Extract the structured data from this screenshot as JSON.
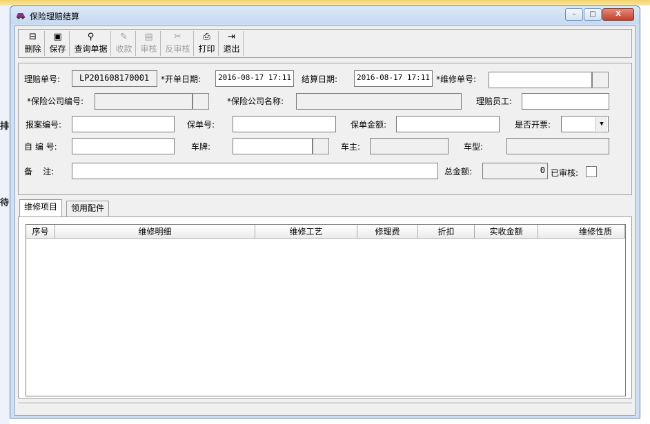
{
  "window": {
    "title": "保险理赔结算",
    "buttons": {
      "minimize": "–",
      "maximize": "□",
      "close": "X"
    }
  },
  "desktop": {
    "left_chars": [
      "排",
      "待"
    ]
  },
  "toolbar": [
    {
      "label": "删除",
      "icon": "delete-icon",
      "glyph": "⊟",
      "enabled": true
    },
    {
      "label": "保存",
      "icon": "save-icon",
      "glyph": "▣",
      "enabled": true
    },
    {
      "label": "查询单据",
      "icon": "binoculars-icon",
      "glyph": "⚲",
      "enabled": true
    },
    {
      "label": "收款",
      "icon": "receive-icon",
      "glyph": "✎",
      "enabled": false
    },
    {
      "label": "审核",
      "icon": "audit-icon",
      "glyph": "▤",
      "enabled": false
    },
    {
      "label": "反审核",
      "icon": "unaudit-icon",
      "glyph": "✂",
      "enabled": false
    },
    {
      "label": "打印",
      "icon": "printer-icon",
      "glyph": "⎙",
      "enabled": true
    },
    {
      "label": "退出",
      "icon": "exit-icon",
      "glyph": "⇥",
      "enabled": true
    }
  ],
  "form": {
    "claim_no_label": "理赔单号:",
    "claim_no": "LP201608170001",
    "open_date_label": "*开单日期:",
    "open_date": "2016-08-17 17:11",
    "settle_date_label": "结算日期:",
    "settle_date": "2016-08-17 17:11",
    "repair_no_label": "*维修单号:",
    "repair_no": "",
    "ins_code_label": "*保险公司编号:",
    "ins_code": "",
    "ins_name_label": "*保险公司名称:",
    "ins_name": "",
    "claim_staff_label": "理赔员工:",
    "claim_staff": "",
    "report_no_label": "报案编号:",
    "report_no": "",
    "policy_no_label": "保单号:",
    "policy_no": "",
    "policy_amount_label": "保单金额:",
    "policy_amount": "",
    "invoice_label": "是否开票:",
    "invoice": "",
    "self_no_label": "自 编 号:",
    "self_no": "",
    "plate_label": "车牌:",
    "plate": "",
    "owner_label": "车主:",
    "owner": "",
    "model_label": "车型:",
    "model": "",
    "remark_label": "备    注:",
    "remark": "",
    "total_label": "总金额:",
    "total": "0",
    "audited_label": "已审核:",
    "audited": false
  },
  "tabs": [
    {
      "label": "维修项目",
      "active": true
    },
    {
      "label": "领用配件",
      "active": false
    }
  ],
  "grid": {
    "columns": [
      "序号",
      "维修明细",
      "维修工艺",
      "修理费",
      "折扣",
      "实收金额",
      "维修性质"
    ],
    "rows": []
  }
}
